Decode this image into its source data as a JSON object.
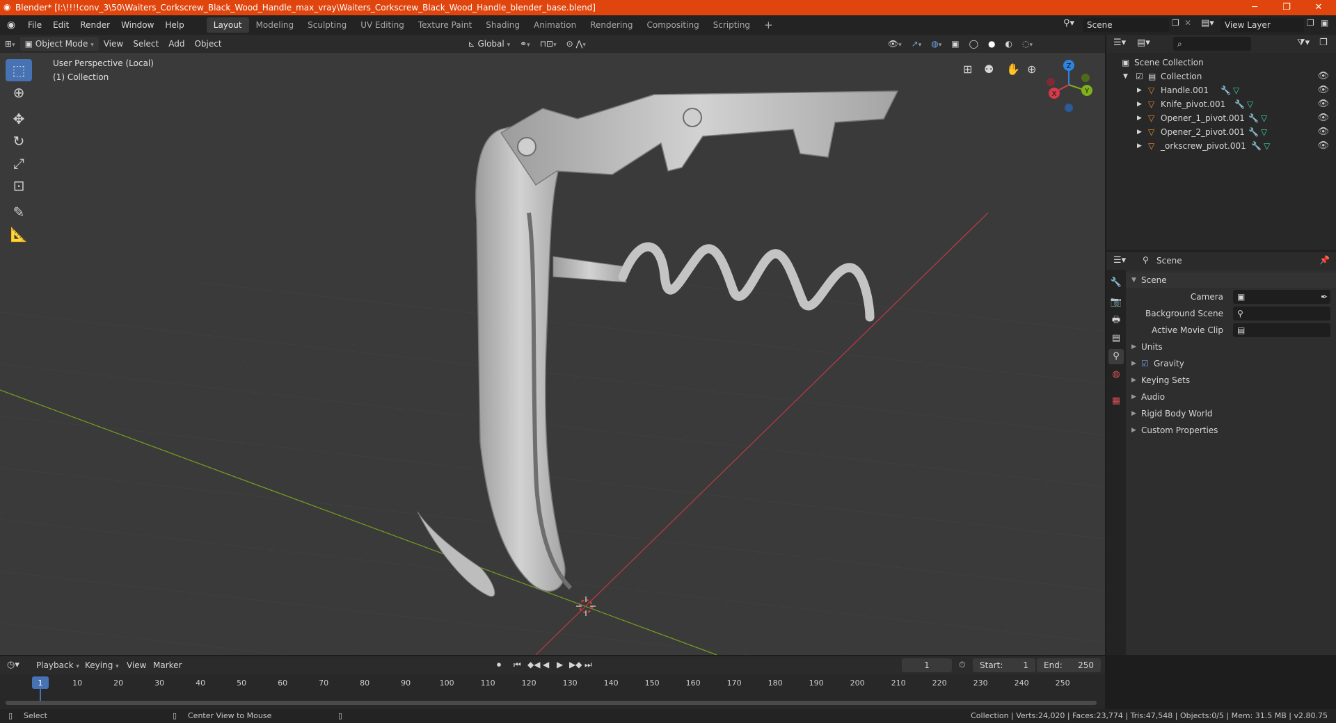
{
  "window": {
    "title": "Blender* [I:\\!!!!conv_3\\50\\Waiters_Corkscrew_Black_Wood_Handle_max_vray\\Waiters_Corkscrew_Black_Wood_Handle_blender_base.blend]",
    "minimize": "─",
    "maximize": "❐",
    "close": "✕"
  },
  "menu": [
    "File",
    "Edit",
    "Render",
    "Window",
    "Help"
  ],
  "workspaces": [
    "Layout",
    "Modeling",
    "Sculpting",
    "UV Editing",
    "Texture Paint",
    "Shading",
    "Animation",
    "Rendering",
    "Compositing",
    "Scripting"
  ],
  "workspace_add": "+",
  "scene_field": "Scene",
  "view_layer_field": "View Layer",
  "viewport_header": {
    "mode": "Object Mode",
    "menus": [
      "View",
      "Select",
      "Add",
      "Object"
    ],
    "transform_orientation": "Global"
  },
  "viewport": {
    "perspective": "User Perspective (Local)",
    "collection": "(1) Collection",
    "gizmo": {
      "x": "X",
      "y": "Y",
      "z": "Z"
    }
  },
  "outliner": {
    "root": "Scene Collection",
    "collection": "Collection",
    "objects": [
      "Handle.001",
      "Knife_pivot.001",
      "Opener_1_pivot.001",
      "Opener_2_pivot.001",
      "_orkscrew_pivot.001"
    ]
  },
  "properties": {
    "header": "Scene",
    "panel": "Scene",
    "fields": [
      {
        "label": "Camera"
      },
      {
        "label": "Background Scene"
      },
      {
        "label": "Active Movie Clip"
      }
    ],
    "sections": [
      "Units",
      "Gravity",
      "Keying Sets",
      "Audio",
      "Rigid Body World",
      "Custom Properties"
    ]
  },
  "timeline": {
    "menus": [
      "Playback",
      "Keying",
      "View",
      "Marker"
    ],
    "current_frame": "1",
    "start_label": "Start:",
    "start": "1",
    "end_label": "End:",
    "end": "250",
    "ticks": [
      "1",
      "10",
      "20",
      "30",
      "40",
      "50",
      "60",
      "70",
      "80",
      "90",
      "100",
      "110",
      "120",
      "130",
      "140",
      "150",
      "160",
      "170",
      "180",
      "190",
      "200",
      "210",
      "220",
      "230",
      "240",
      "250"
    ]
  },
  "status": {
    "select": "Select",
    "center": "Center View to Mouse",
    "stats": "Collection | Verts:24,020 | Faces:23,774 | Tris:47,548 | Objects:0/5 | Mem: 31.5 MB | v2.80.75"
  },
  "colors": {
    "titlebar": "#e0450e",
    "active_tool": "#4772b3",
    "x_axis": "#d63a4b",
    "y_axis": "#7fb21a",
    "z_axis": "#2f83e0",
    "frame_marker": "#4772b3"
  }
}
